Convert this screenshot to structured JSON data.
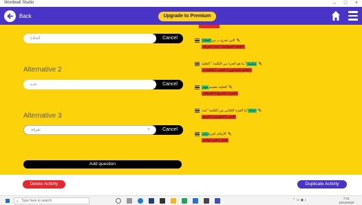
{
  "window": {
    "title": "Wordwall Studio"
  },
  "appbar": {
    "back_label": "Back",
    "upgrade_label": "Upgrade to Premium"
  },
  "alternatives": [
    {
      "label": "",
      "value": "الخلايا",
      "cancel": "Cancel"
    },
    {
      "label": "Alternative 2",
      "value": "عدة",
      "cancel": "Cancel"
    },
    {
      "label": "Alternative 3",
      "value": "تفرقة",
      "cancel": "Cancel"
    }
  ],
  "add_question_label": "Add question",
  "questions": [
    {
      "text": "التي تخرج ـــ من",
      "highlight": "الخلايا",
      "answers": "الخلية الحيوانية | عدة | تفرقة"
    },
    {
      "text": "ما هو الجزء من الكلمة \" الخلية \" ",
      "highlight": "سليمة",
      "answers": "الكلمة المذكورة | العيب | الكلمات"
    },
    {
      "text": "الخلية تنقسم",
      "highlight": "مهم",
      "answers": "الجزء | التاريخ | الاشكال"
    },
    {
      "text": "ما الجزء الكتابي من الكلمة \"عدد\"",
      "highlight": "تعداد",
      "answers": "العدد | التقسيم | الجمع"
    },
    {
      "text": "الأرقام كثيرة",
      "highlight": "عدد",
      "answers": "قليل | كثير | واحد"
    }
  ],
  "bottom": {
    "delete_label": "Delete Activity",
    "duplicate_label": "Duplicate Activity"
  },
  "taskbar": {
    "search_placeholder": "Type here to search",
    "time": "7:41",
    "date": "10/13/2020"
  },
  "colors": {
    "brand": "#4a33c7",
    "panel": "#fcd20b",
    "upgrade": "#ffd21a",
    "danger": "#e8262c",
    "highlight": "#29c37a"
  }
}
